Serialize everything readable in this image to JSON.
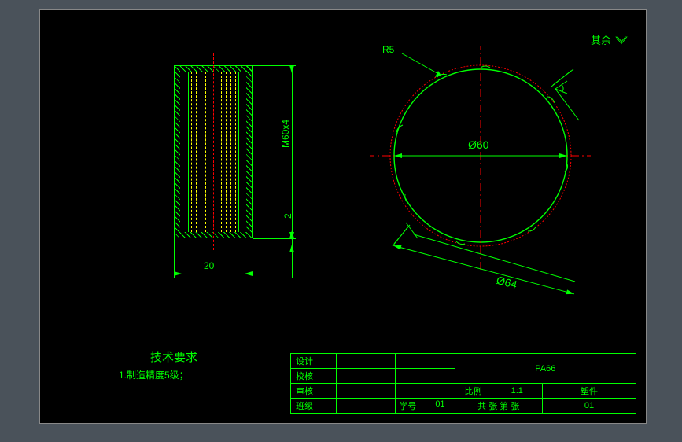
{
  "surface_note": "其余",
  "callout_r5": "R5",
  "dims": {
    "d20": "20",
    "m60x4": "M60x4",
    "gap2": "2",
    "phi60": "Ø60",
    "phi64": "Ø64"
  },
  "tech_req": {
    "title": "技术要求",
    "line1": "1.制造精度5级；"
  },
  "title_block": {
    "r1c1": "设计",
    "r2c1": "校核",
    "r3c1": "审核",
    "r4c1": "班级",
    "r4c3_lbl": "学号",
    "r4c3_val": "01",
    "material": "PA66",
    "scale_lbl": "比例",
    "scale_val": "1:1",
    "part_type": "塑件",
    "sheet_text": "共  张 第  张",
    "sheet_no": "01"
  },
  "chart_data": {
    "type": "engineering_drawing",
    "views": [
      {
        "name": "section",
        "features": [
          "internal_thread",
          "hatching"
        ],
        "dimensions": {
          "width": 20,
          "thread_spec": "M60x4",
          "chamfer": 2
        }
      },
      {
        "name": "end_view",
        "features": [
          "circle",
          "wavy_knurl_outline",
          "fillet"
        ],
        "dimensions": {
          "inner_diameter": 60,
          "outer_diameter": 64,
          "fillet_radius": 5
        }
      }
    ],
    "material": "PA66",
    "scale": "1:1",
    "precision_grade": 5
  }
}
